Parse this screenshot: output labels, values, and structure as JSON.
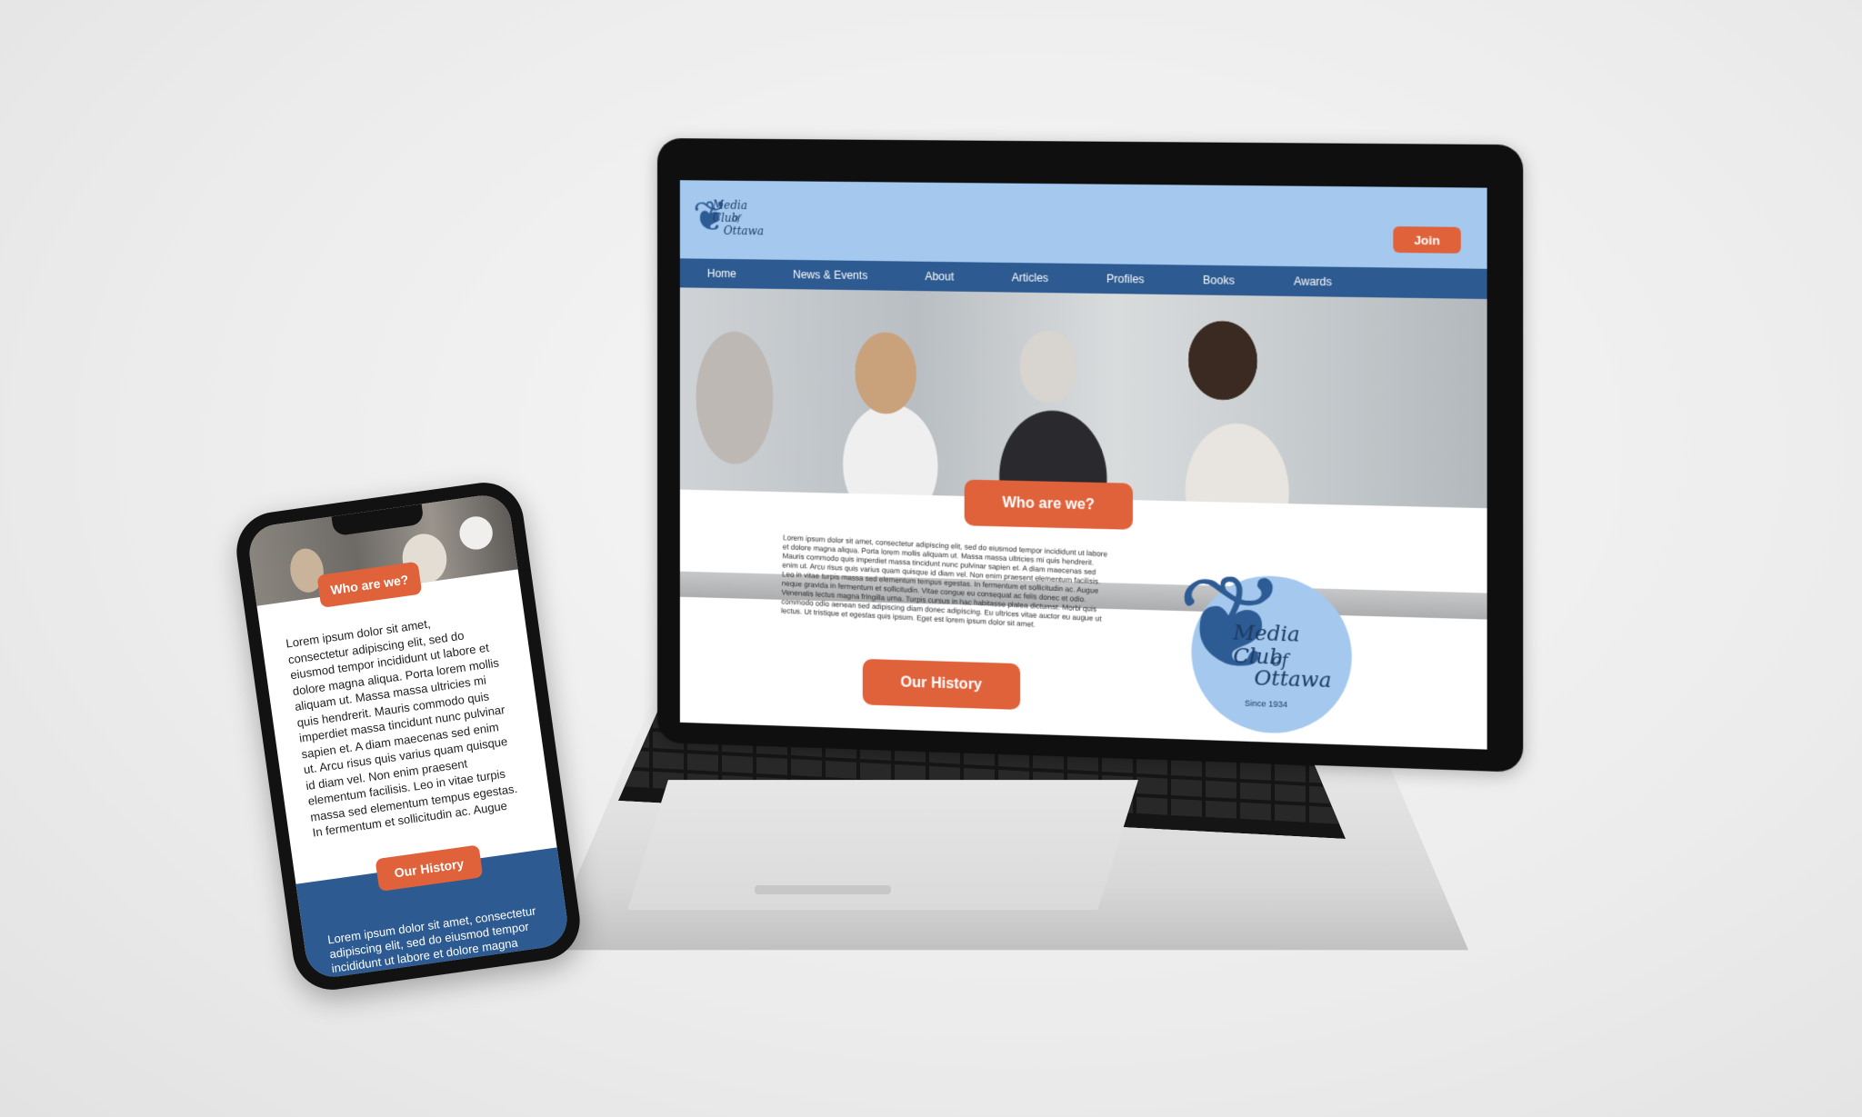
{
  "site": {
    "logo": {
      "line1": "Media Club",
      "line2": "of",
      "line3": "Ottawa"
    },
    "join_label": "Join",
    "nav": [
      "Home",
      "News & Events",
      "About",
      "Articles",
      "Profiles",
      "Books",
      "Awards"
    ],
    "who_label": "Who are we?",
    "history_label": "Our History",
    "intro_text": "Lorem ipsum dolor sit amet, consectetur adipiscing elit, sed do eiusmod tempor incididunt ut labore et dolore magna aliqua. Porta lorem mollis aliquam ut. Massa massa ultricies mi quis hendrerit. Mauris commodo quis imperdiet massa tincidunt nunc pulvinar sapien et. A diam maecenas sed enim ut. Arcu risus quis varius quam quisque id diam vel. Non enim praesent elementum facilisis. Leo in vitae turpis massa sed elementum tempus egestas. In fermentum et sollicitudin ac. Augue neque gravida in fermentum et sollicitudin. Vitae congue eu consequat ac felis donec et odio. Venenatis lectus magna fringilla urna. Turpis cursus in hac habitasse platea dictumst. Morbi quis commodo odio aenean sed adipiscing diam donec adipiscing. Eu ultrices vitae auctor eu augue ut lectus. Ut tristique et egestas quis ipsum. Eget est lorem ipsum dolor sit amet.",
    "club_logo": {
      "line1": "Media Club",
      "line2": "of",
      "line3": "Ottawa",
      "since": "Since 1934"
    }
  },
  "phone": {
    "who_label": "Who are we?",
    "history_label": "Our History",
    "intro_text": "Lorem ipsum dolor sit amet, consectetur adipiscing elit, sed do eiusmod tempor incididunt ut labore et dolore magna aliqua. Porta lorem mollis aliquam ut. Massa massa ultricies mi quis hendrerit. Mauris commodo quis imperdiet massa tincidunt nunc pulvinar sapien et. A diam maecenas sed enim ut. Arcu risus quis varius quam quisque id diam vel. Non enim praesent elementum facilisis. Leo in vitae turpis massa sed elementum tempus egestas. In fermentum et sollicitudin ac. Augue",
    "history_text": "Lorem ipsum dolor sit amet, consectetur adipiscing elit, sed do eiusmod tempor incididunt ut labore et dolore magna aliqua. Porta lorem"
  },
  "colors": {
    "header_blue": "#a4c8ee",
    "nav_blue": "#2c5a91",
    "accent_orange": "#e0623b"
  }
}
